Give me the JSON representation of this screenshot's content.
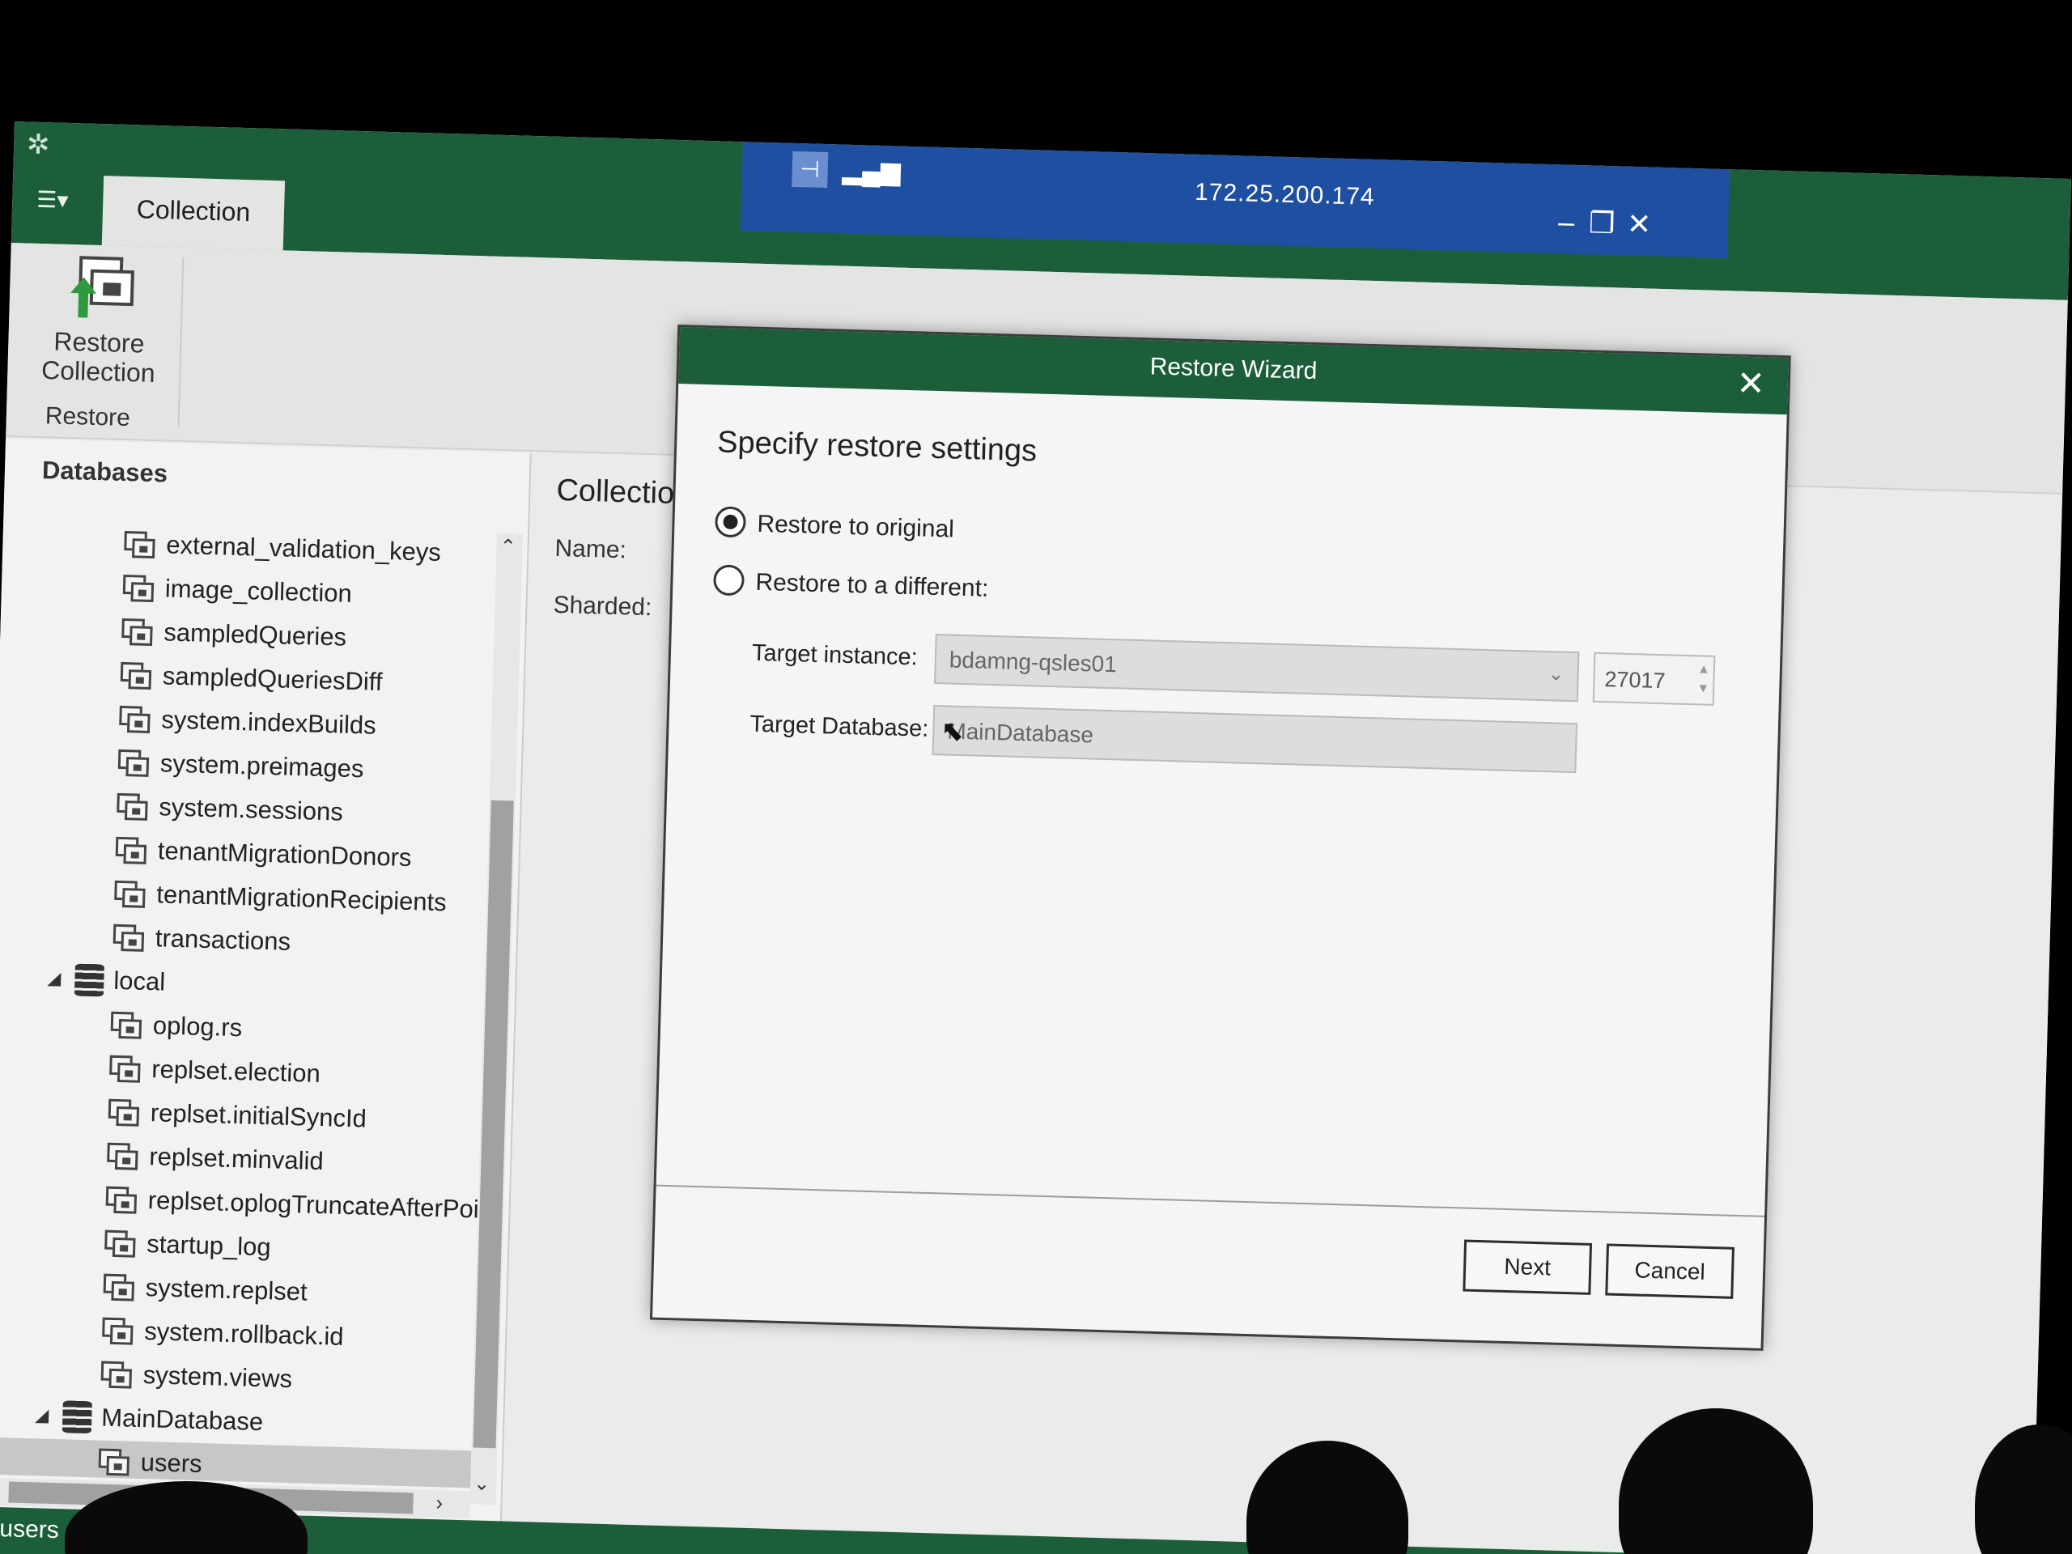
{
  "app": {
    "menu_icon": "hamburger-dropdown-icon",
    "ribbon_tab": "Collection",
    "restore_button_label": "Restore\nCollection",
    "restore_group_label": "Restore"
  },
  "connection": {
    "ip": "172.25.200.174",
    "pin_icon": "pin-icon",
    "signal_icon": "signal-icon"
  },
  "tree": {
    "header": "Databases",
    "items": [
      {
        "label": "external_validation_keys",
        "kind": "collection"
      },
      {
        "label": "image_collection",
        "kind": "collection"
      },
      {
        "label": "sampledQueries",
        "kind": "collection"
      },
      {
        "label": "sampledQueriesDiff",
        "kind": "collection"
      },
      {
        "label": "system.indexBuilds",
        "kind": "collection"
      },
      {
        "label": "system.preimages",
        "kind": "collection"
      },
      {
        "label": "system.sessions",
        "kind": "collection"
      },
      {
        "label": "tenantMigrationDonors",
        "kind": "collection"
      },
      {
        "label": "tenantMigrationRecipients",
        "kind": "collection"
      },
      {
        "label": "transactions",
        "kind": "collection"
      },
      {
        "label": "local",
        "kind": "database"
      },
      {
        "label": "oplog.rs",
        "kind": "collection"
      },
      {
        "label": "replset.election",
        "kind": "collection"
      },
      {
        "label": "replset.initialSyncId",
        "kind": "collection"
      },
      {
        "label": "replset.minvalid",
        "kind": "collection"
      },
      {
        "label": "replset.oplogTruncateAfterPoi",
        "kind": "collection"
      },
      {
        "label": "startup_log",
        "kind": "collection"
      },
      {
        "label": "system.replset",
        "kind": "collection"
      },
      {
        "label": "system.rollback.id",
        "kind": "collection"
      },
      {
        "label": "system.views",
        "kind": "collection"
      },
      {
        "label": "MainDatabase",
        "kind": "database"
      },
      {
        "label": "users",
        "kind": "collection",
        "selected": true
      }
    ]
  },
  "details": {
    "title": "Collection",
    "name_label": "Name:",
    "sharded_label": "Sharded:"
  },
  "status": {
    "text": "users"
  },
  "wizard": {
    "title": "Restore Wizard",
    "heading": "Specify restore settings",
    "option_original": "Restore to original",
    "option_different": "Restore to a different:",
    "selected_option": "Restore to original",
    "target_instance_label": "Target instance:",
    "target_instance_value": "bdamng-qsles01",
    "port_value": "27017",
    "target_database_label": "Target Database:",
    "target_database_value": "MainDatabase",
    "next_label": "Next",
    "cancel_label": "Cancel"
  },
  "colors": {
    "brand_green": "#1d5e3a",
    "connection_blue": "#1f4fa0",
    "background": "#e9ebe9"
  }
}
